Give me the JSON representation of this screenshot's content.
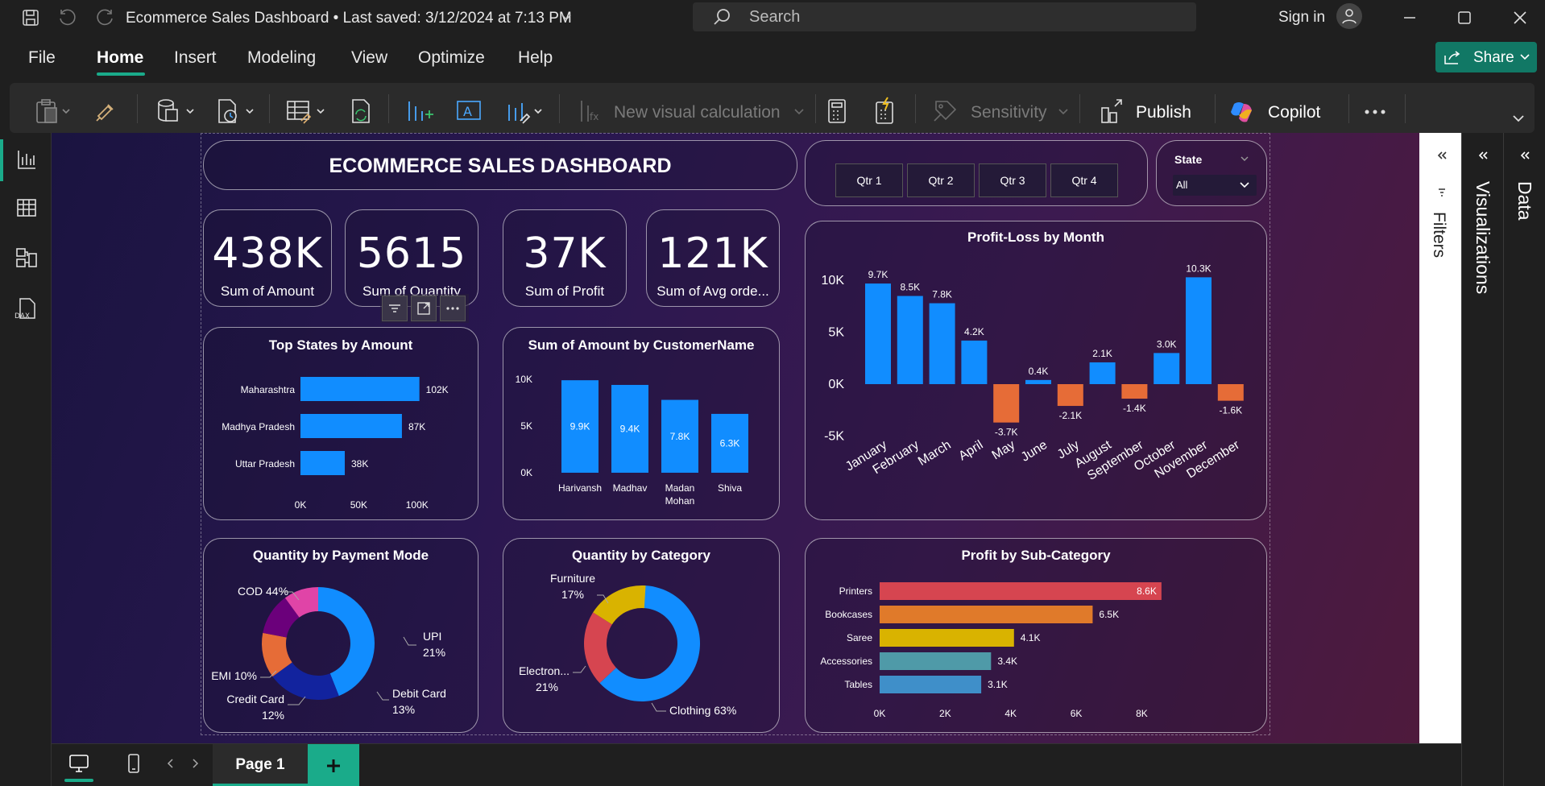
{
  "window": {
    "title": "Ecommerce Sales Dashboard • Last saved: 3/12/2024 at 7:13 PM",
    "search_placeholder": "Search",
    "sign_in": "Sign in"
  },
  "menu": {
    "items": [
      "File",
      "Home",
      "Insert",
      "Modeling",
      "View",
      "Optimize",
      "Help"
    ],
    "active": "Home",
    "share": "Share"
  },
  "ribbon": {
    "new_visual_calc": "New visual calculation",
    "sensitivity": "Sensitivity",
    "publish": "Publish",
    "copilot": "Copilot"
  },
  "right_panels": {
    "filters": "Filters",
    "visualizations": "Visualizations",
    "data": "Data"
  },
  "bottom": {
    "page_tab": "Page 1"
  },
  "dashboard": {
    "title": "ECOMMERCE SALES DASHBOARD",
    "quarters": [
      "Qtr 1",
      "Qtr 2",
      "Qtr 3",
      "Qtr 4"
    ],
    "state_label": "State",
    "state_value": "All",
    "kpis": [
      {
        "value": "438K",
        "label": "Sum of Amount"
      },
      {
        "value": "5615",
        "label": "Sum of Quantity"
      },
      {
        "value": "37K",
        "label": "Sum of Profit"
      },
      {
        "value": "121K",
        "label": "Sum of Avg orde..."
      }
    ]
  },
  "colors": {
    "blue": "#118dff",
    "orange": "#e66c37",
    "accent_green": "#1aab8a",
    "canvas_start": "#1a1440",
    "canvas_end": "#4e1a3c"
  },
  "chart_data": [
    {
      "id": "top_states",
      "type": "bar",
      "orientation": "horizontal",
      "title": "Top States by Amount",
      "categories": [
        "Maharashtra",
        "Madhya Pradesh",
        "Uttar Pradesh"
      ],
      "values": [
        102000,
        87000,
        38000
      ],
      "value_labels": [
        "102K",
        "87K",
        "38K"
      ],
      "xticks": [
        "0K",
        "50K",
        "100K"
      ],
      "xlim": [
        0,
        105000
      ],
      "color": "#118dff"
    },
    {
      "id": "amount_by_customer",
      "type": "bar",
      "title": "Sum of Amount by CustomerName",
      "categories": [
        "Harivansh",
        "Madhav",
        "Madan Mohan",
        "Shiva"
      ],
      "values": [
        9900,
        9400,
        7800,
        6300
      ],
      "value_labels": [
        "9.9K",
        "9.4K",
        "7.8K",
        "6.3K"
      ],
      "yticks": [
        "10K",
        "5K",
        "0K"
      ],
      "ylim": [
        0,
        10000
      ],
      "color": "#118dff"
    },
    {
      "id": "profit_by_month",
      "type": "bar",
      "title": "Profit-Loss by Month",
      "categories": [
        "January",
        "February",
        "March",
        "April",
        "May",
        "June",
        "July",
        "August",
        "September",
        "October",
        "November",
        "December"
      ],
      "values": [
        9700,
        8500,
        7800,
        4200,
        -3700,
        400,
        -2100,
        2100,
        -1400,
        3000,
        10300,
        -1600
      ],
      "value_labels": [
        "9.7K",
        "8.5K",
        "7.8K",
        "4.2K",
        "-3.7K",
        "0.4K",
        "-2.1K",
        "2.1K",
        "-1.4K",
        "3.0K",
        "10.3K",
        "-1.6K"
      ],
      "yticks": [
        "10K",
        "5K",
        "0K",
        "-5K"
      ],
      "ylim": [
        -5000,
        10000
      ],
      "positive_color": "#118dff",
      "negative_color": "#e66c37"
    },
    {
      "id": "qty_by_payment",
      "type": "pie",
      "donut": true,
      "title": "Quantity by Payment Mode",
      "slices": [
        {
          "name": "COD",
          "pct": 44,
          "color": "#118dff",
          "label": "COD 44%"
        },
        {
          "name": "UPI",
          "pct": 21,
          "color": "#12239e",
          "label": "UPI 21%"
        },
        {
          "name": "Debit Card",
          "pct": 13,
          "color": "#e66c37",
          "label": "Debit Card 13%"
        },
        {
          "name": "Credit Card",
          "pct": 12,
          "color": "#6b007b",
          "label": "Credit Card 12%"
        },
        {
          "name": "EMI",
          "pct": 10,
          "color": "#e044a7",
          "label": "EMI 10%"
        }
      ]
    },
    {
      "id": "qty_by_category",
      "type": "pie",
      "donut": true,
      "title": "Quantity by Category",
      "slices": [
        {
          "name": "Clothing",
          "pct": 63,
          "color": "#118dff",
          "label": "Clothing 63%"
        },
        {
          "name": "Electron...",
          "pct": 21,
          "color": "#d64550",
          "label": "Electron... 21%"
        },
        {
          "name": "Furniture",
          "pct": 17,
          "color": "#d9b300",
          "label": "Furniture 17%"
        }
      ]
    },
    {
      "id": "profit_by_subcat",
      "type": "bar",
      "orientation": "horizontal",
      "title": "Profit by Sub-Category",
      "categories": [
        "Printers",
        "Bookcases",
        "Saree",
        "Accessories",
        "Tables"
      ],
      "values": [
        8600,
        6500,
        4100,
        3400,
        3100
      ],
      "value_labels": [
        "8.6K",
        "6.5K",
        "4.1K",
        "3.4K",
        "3.1K"
      ],
      "colors": [
        "#d64550",
        "#e07a2a",
        "#d9b300",
        "#4f9aa8",
        "#3f8fc9"
      ],
      "xticks": [
        "0K",
        "2K",
        "4K",
        "6K",
        "8K"
      ],
      "xlim": [
        0,
        8800
      ]
    }
  ]
}
